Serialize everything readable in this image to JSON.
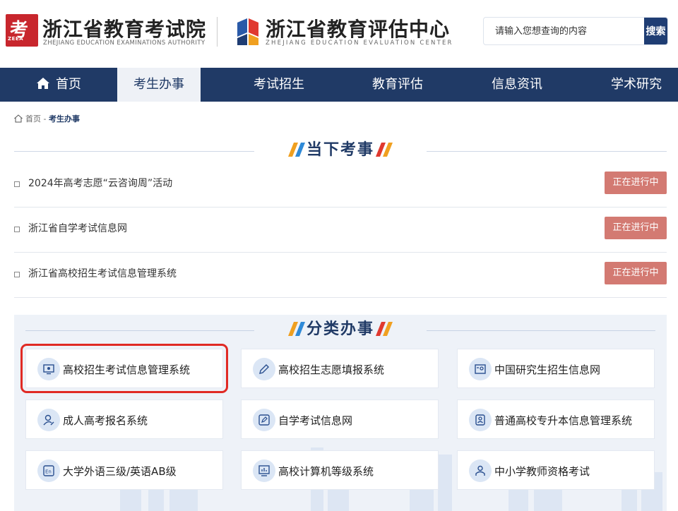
{
  "header": {
    "logo1_char": "考",
    "logo1_abbr": "ZEEA",
    "brand1_title": "浙江省教育考试院",
    "brand1_sub": "ZHEJIANG EDUCATION EXAMINATIONS AUTHORITY",
    "brand2_title": "浙江省教育评估中心",
    "brand2_sub": "ZHEJIANG EDUCATION EVALUATION CENTER",
    "search_placeholder": "请输入您想查询的内容",
    "search_button": "搜索"
  },
  "nav": {
    "items": [
      "首页",
      "考生办事",
      "考试招生",
      "教育评估",
      "信息资讯",
      "学术研究"
    ],
    "active": "考生办事"
  },
  "breadcrumb": {
    "home": "首页",
    "sep": "-",
    "current": "考生办事"
  },
  "current_section": {
    "title": "当下考事",
    "items": [
      {
        "label": "2024年高考志愿“云咨询周”活动",
        "status": "正在进行中"
      },
      {
        "label": "浙江省自学考试信息网",
        "status": "正在进行中"
      },
      {
        "label": "浙江省高校招生考试信息管理系统",
        "status": "正在进行中"
      }
    ]
  },
  "category_section": {
    "title": "分类办事",
    "cards": [
      {
        "label": "高校招生考试信息管理系统",
        "icon": "monitor-icon",
        "highlighted": true
      },
      {
        "label": "高校招生志愿填报系统",
        "icon": "pencil-icon"
      },
      {
        "label": "中国研究生招生信息网",
        "icon": "id-card-icon"
      },
      {
        "label": "成人高考报名系统",
        "icon": "user-edit-icon"
      },
      {
        "label": "自学考试信息网",
        "icon": "edit-screen-icon"
      },
      {
        "label": "普通高校专升本信息管理系统",
        "icon": "person-badge-icon"
      },
      {
        "label": "大学外语三级/英语AB级",
        "icon": "en-icon"
      },
      {
        "label": "高校计算机等级系统",
        "icon": "chart-monitor-icon"
      },
      {
        "label": "中小学教师资格考试",
        "icon": "teacher-icon"
      }
    ]
  },
  "colors": {
    "nav_bg": "#203a66",
    "status_bg": "#d37a72",
    "highlight": "#e02a24",
    "brand_red": "#c8262d"
  }
}
